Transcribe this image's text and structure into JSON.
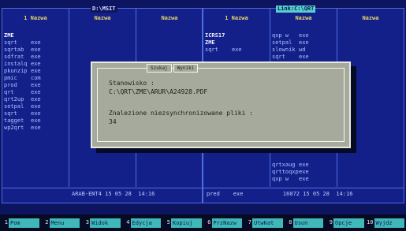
{
  "left_panel": {
    "title": "D:\\MSIT",
    "col1_header": "1 Nazwa",
    "col2_header": "Nazwa",
    "col3_header": "Nazwa",
    "files": [
      {
        "name": "ZME",
        "ext": "",
        "dir": true
      },
      {
        "name": "sqrt",
        "ext": "exe"
      },
      {
        "name": "sqrtab",
        "ext": "exe"
      },
      {
        "name": "sdfrat",
        "ext": "exe"
      },
      {
        "name": "instalq",
        "ext": "exe"
      },
      {
        "name": "pkunzip",
        "ext": "exe"
      },
      {
        "name": "pmic",
        "ext": "com"
      },
      {
        "name": "prod",
        "ext": "exe"
      },
      {
        "name": "qrt",
        "ext": "exe"
      },
      {
        "name": "qrt2up",
        "ext": "exe"
      },
      {
        "name": "setpal",
        "ext": "exe"
      },
      {
        "name": "sqrt",
        "ext": "exe"
      },
      {
        "name": "tagget",
        "ext": "exe"
      },
      {
        "name": "wp2qrt",
        "ext": "exe"
      }
    ],
    "info": "ARAB-ENT4 15 05 28  14:16"
  },
  "right_panel": {
    "title": "Link:C:\\QRT",
    "col1_header": "1 Nazwa",
    "col2_header": "Nazwa",
    "col3_header": "Nazwa",
    "files_col1": [
      {
        "name": "ICRS17",
        "ext": "",
        "dir": true
      },
      {
        "name": "ZME",
        "ext": "",
        "dir": true
      },
      {
        "name": "sqrt",
        "ext": "exe"
      }
    ],
    "files_col2": [
      {
        "name": "qxp w",
        "ext": "exe"
      },
      {
        "name": "setpal",
        "ext": "exe"
      },
      {
        "name": "slownik",
        "ext": "wd"
      },
      {
        "name": "sqrt",
        "ext": "exe"
      }
    ],
    "files_col2_lower": [
      {
        "name": "qrtxaug",
        "ext": "exe"
      },
      {
        "name": "qrttoqxp",
        "ext": "exe"
      },
      {
        "name": "qxp w",
        "ext": "exe"
      }
    ],
    "info": "pred    exe            16072 15 05 28  14:16"
  },
  "dialog": {
    "tab1": "Szukaj",
    "tab2": "Wyniki",
    "label_location": "Stanowisko :",
    "path": "C:\\QRT\\ZME\\ARUR\\A24928.PDF",
    "label_found": "Znalezione niezsynchronizowane pliki :",
    "count": "34"
  },
  "fkeys": [
    {
      "num": "1",
      "label": "Pom"
    },
    {
      "num": "2",
      "label": "Menu"
    },
    {
      "num": "3",
      "label": "Widok"
    },
    {
      "num": "4",
      "label": "Edycja"
    },
    {
      "num": "5",
      "label": "Kopiuj"
    },
    {
      "num": "6",
      "label": "PrzNazw"
    },
    {
      "num": "7",
      "label": "UtwKat"
    },
    {
      "num": "8",
      "label": "Usun"
    },
    {
      "num": "9",
      "label": "Opcje"
    },
    {
      "num": "10",
      "label": "Wyjdz"
    }
  ],
  "colors": {
    "panel_bg": "#13208a",
    "border": "#4d6de0",
    "header": "#e6d56a",
    "fkey_bg": "#40b8b8",
    "dialog_bg": "#a6aa9c"
  }
}
